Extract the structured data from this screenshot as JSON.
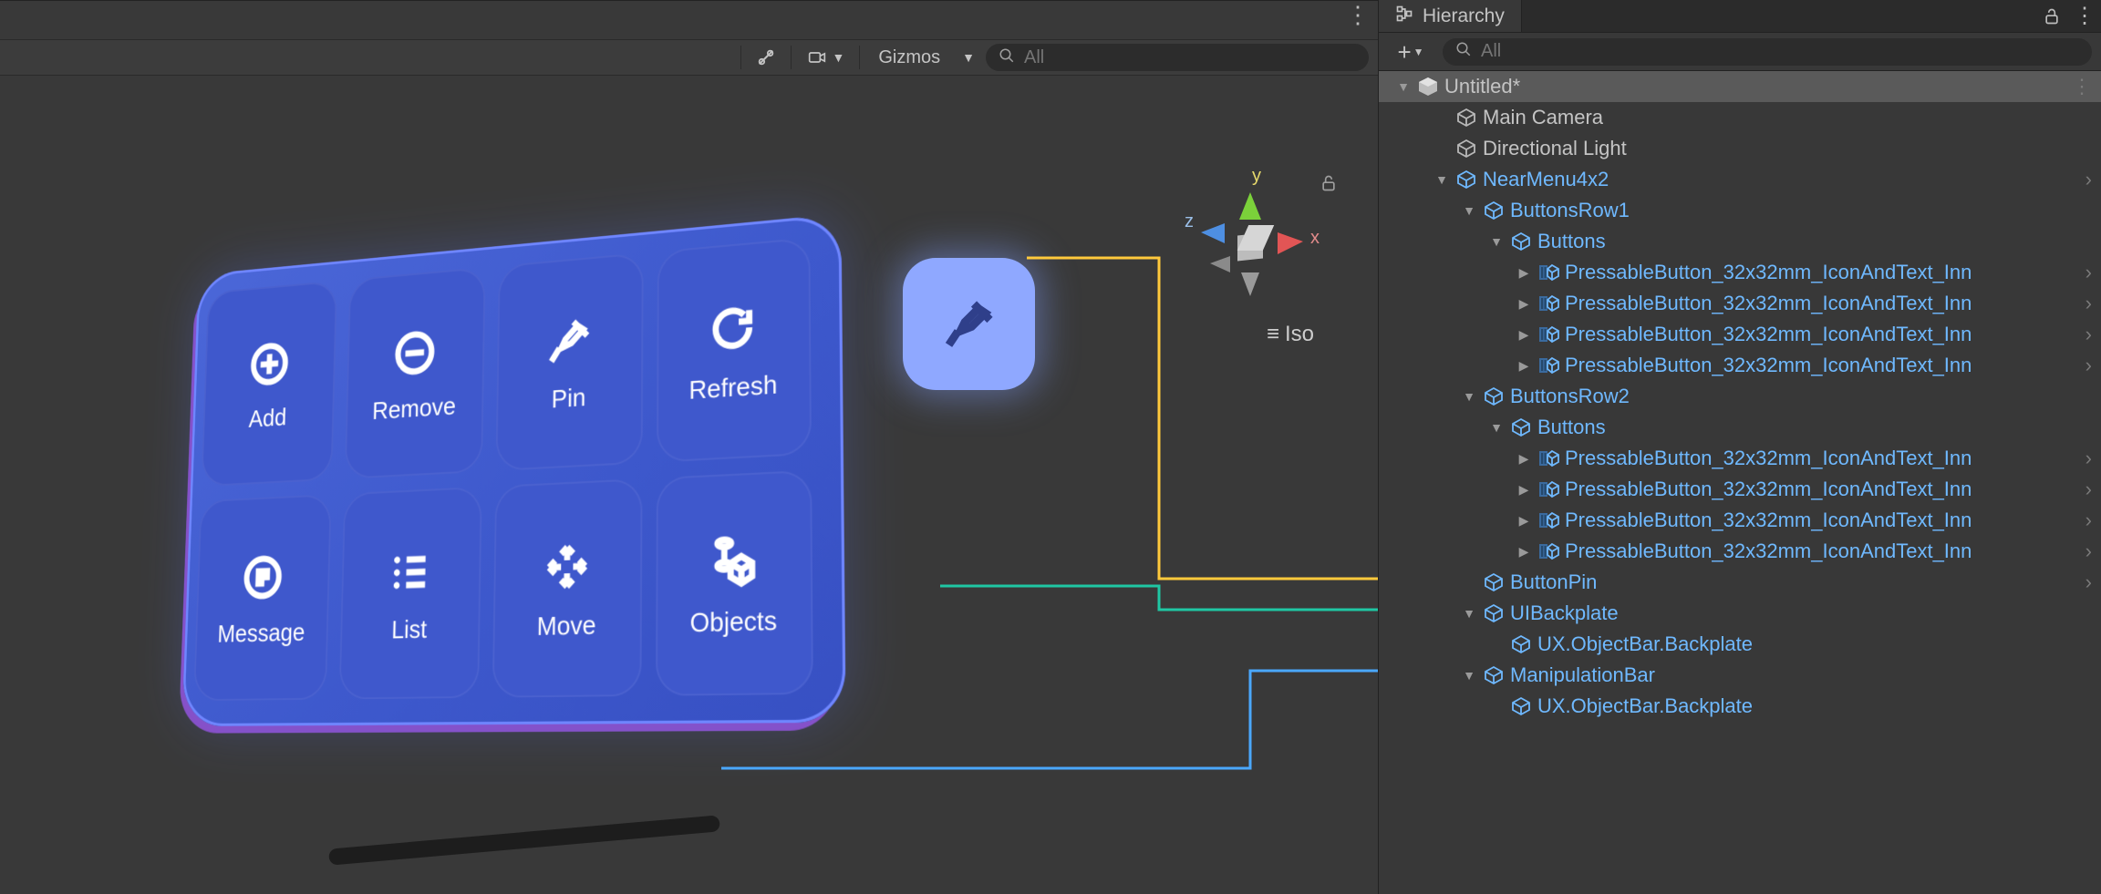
{
  "scene_toolbar": {
    "gizmos_label": "Gizmos",
    "search_placeholder": "All"
  },
  "orientation": {
    "x_label": "x",
    "y_label": "y",
    "z_label": "z",
    "projection_label": "Iso"
  },
  "near_menu": {
    "buttons": [
      {
        "label": "Add",
        "icon": "plus-circle-icon"
      },
      {
        "label": "Remove",
        "icon": "minus-circle-icon"
      },
      {
        "label": "Pin",
        "icon": "pin-icon"
      },
      {
        "label": "Refresh",
        "icon": "refresh-icon"
      },
      {
        "label": "Message",
        "icon": "message-icon"
      },
      {
        "label": "List",
        "icon": "list-icon"
      },
      {
        "label": "Move",
        "icon": "move-icon"
      },
      {
        "label": "Objects",
        "icon": "objects-icon"
      }
    ]
  },
  "hierarchy": {
    "tab_title": "Hierarchy",
    "search_placeholder": "All",
    "scene_name": "Untitled*",
    "tree": [
      {
        "depth": 1,
        "fold": "",
        "icon": "cube-grey",
        "label": "Main Camera",
        "blue": false,
        "chev": false
      },
      {
        "depth": 1,
        "fold": "",
        "icon": "cube-grey",
        "label": "Directional Light",
        "blue": false,
        "chev": false
      },
      {
        "depth": 1,
        "fold": "▼",
        "icon": "cube-blue",
        "label": "NearMenu4x2",
        "blue": true,
        "chev": true
      },
      {
        "depth": 2,
        "fold": "▼",
        "icon": "cube-blue",
        "label": "ButtonsRow1",
        "blue": true,
        "chev": false
      },
      {
        "depth": 3,
        "fold": "▼",
        "icon": "cube-blue",
        "label": "Buttons",
        "blue": true,
        "chev": false
      },
      {
        "depth": 4,
        "fold": "▶",
        "icon": "prefab",
        "label": "PressableButton_32x32mm_IconAndText_Inn",
        "blue": true,
        "chev": true
      },
      {
        "depth": 4,
        "fold": "▶",
        "icon": "prefab",
        "label": "PressableButton_32x32mm_IconAndText_Inn",
        "blue": true,
        "chev": true
      },
      {
        "depth": 4,
        "fold": "▶",
        "icon": "prefab",
        "label": "PressableButton_32x32mm_IconAndText_Inn",
        "blue": true,
        "chev": true
      },
      {
        "depth": 4,
        "fold": "▶",
        "icon": "prefab",
        "label": "PressableButton_32x32mm_IconAndText_Inn",
        "blue": true,
        "chev": true
      },
      {
        "depth": 2,
        "fold": "▼",
        "icon": "cube-blue",
        "label": "ButtonsRow2",
        "blue": true,
        "chev": false
      },
      {
        "depth": 3,
        "fold": "▼",
        "icon": "cube-blue",
        "label": "Buttons",
        "blue": true,
        "chev": false
      },
      {
        "depth": 4,
        "fold": "▶",
        "icon": "prefab",
        "label": "PressableButton_32x32mm_IconAndText_Inn",
        "blue": true,
        "chev": true
      },
      {
        "depth": 4,
        "fold": "▶",
        "icon": "prefab",
        "label": "PressableButton_32x32mm_IconAndText_Inn",
        "blue": true,
        "chev": true
      },
      {
        "depth": 4,
        "fold": "▶",
        "icon": "prefab",
        "label": "PressableButton_32x32mm_IconAndText_Inn",
        "blue": true,
        "chev": true
      },
      {
        "depth": 4,
        "fold": "▶",
        "icon": "prefab",
        "label": "PressableButton_32x32mm_IconAndText_Inn",
        "blue": true,
        "chev": true
      },
      {
        "depth": 2,
        "fold": "",
        "icon": "cube-blue",
        "label": "ButtonPin",
        "blue": true,
        "chev": true
      },
      {
        "depth": 2,
        "fold": "▼",
        "icon": "cube-blue",
        "label": "UIBackplate",
        "blue": true,
        "chev": false
      },
      {
        "depth": 3,
        "fold": "",
        "icon": "cube-blue",
        "label": "UX.ObjectBar.Backplate",
        "blue": true,
        "chev": false
      },
      {
        "depth": 2,
        "fold": "▼",
        "icon": "cube-blue",
        "label": "ManipulationBar",
        "blue": true,
        "chev": false
      },
      {
        "depth": 3,
        "fold": "",
        "icon": "cube-blue",
        "label": "UX.ObjectBar.Backplate",
        "blue": true,
        "chev": false
      }
    ]
  },
  "connectors": {
    "teal": "#1fc7a4",
    "yellow": "#ffc93c",
    "blue": "#4aa8ff"
  }
}
